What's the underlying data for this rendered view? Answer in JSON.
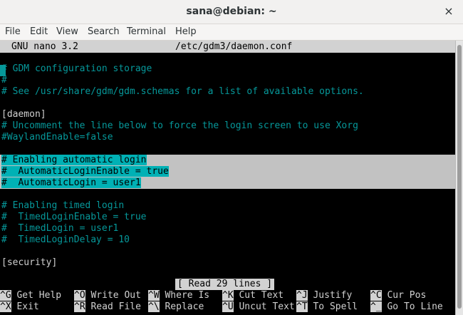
{
  "window": {
    "title": "sana@debian: ~",
    "close_glyph": "×"
  },
  "menu": [
    "File",
    "Edit",
    "View",
    "Search",
    "Terminal",
    "Help"
  ],
  "nano": {
    "version": "GNU nano 3.2",
    "filename": "/etc/gdm3/daemon.conf",
    "lines": [
      "# GDM configuration storage",
      "#",
      "# See /usr/share/gdm/gdm.schemas for a list of available options.",
      "",
      "[daemon]",
      "# Uncomment the line below to force the login screen to use Xorg",
      "#WaylandEnable=false",
      "",
      "# Enabling automatic login",
      "#  AutomaticLoginEnable = true",
      "#  AutomaticLogin = user1",
      "",
      "# Enabling timed login",
      "#  TimedLoginEnable = true",
      "#  TimedLogin = user1",
      "#  TimedLoginDelay = 10",
      "",
      "[security]"
    ],
    "status": "[ Read 29 lines ]",
    "shortcuts_row1": [
      {
        "key": "^G",
        "label": "Get Help"
      },
      {
        "key": "^O",
        "label": "Write Out"
      },
      {
        "key": "^W",
        "label": "Where Is"
      },
      {
        "key": "^K",
        "label": "Cut Text"
      },
      {
        "key": "^J",
        "label": "Justify"
      },
      {
        "key": "^C",
        "label": "Cur Pos"
      }
    ],
    "shortcuts_row2": [
      {
        "key": "^X",
        "label": "Exit"
      },
      {
        "key": "^R",
        "label": "Read File"
      },
      {
        "key": "^\\",
        "label": "Replace"
      },
      {
        "key": "^U",
        "label": "Uncut Text"
      },
      {
        "key": "^T",
        "label": "To Spell"
      },
      {
        "key": "^_",
        "label": "Go To Line"
      }
    ]
  }
}
